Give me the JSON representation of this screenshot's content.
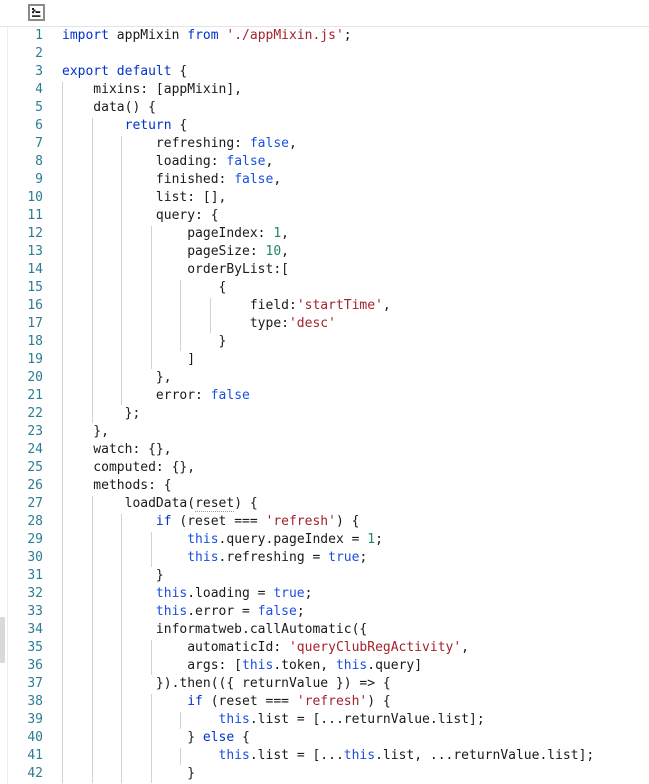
{
  "toolbar": {
    "icon": "terminal-icon",
    "icon_label": ">_"
  },
  "editor": {
    "language": "javascript",
    "first_visible_line": 1,
    "last_visible_line": 42,
    "line_height_px": 18,
    "colors": {
      "background": "#ffffff",
      "keyword": "#0033cc",
      "string": "#a3232e",
      "number": "#1a8a5a",
      "boolean": "#1a4fe0",
      "plain": "#1a1a1a",
      "line_number": "#2b7d95",
      "indent_guide": "#d2d2d2",
      "toolbar_border": "#e4e4e4"
    },
    "lines": [
      {
        "n": "1",
        "indent": 0,
        "tokens": [
          {
            "t": "import",
            "c": "kw"
          },
          {
            "t": " appMixin ",
            "c": "pl"
          },
          {
            "t": "from",
            "c": "kw"
          },
          {
            "t": " ",
            "c": "pl"
          },
          {
            "t": "'./appMixin.js'",
            "c": "str"
          },
          {
            "t": ";",
            "c": "pl"
          }
        ]
      },
      {
        "n": "2",
        "indent": 0,
        "tokens": []
      },
      {
        "n": "3",
        "indent": 0,
        "tokens": [
          {
            "t": "export default",
            "c": "kw"
          },
          {
            "t": " {",
            "c": "pl"
          }
        ]
      },
      {
        "n": "4",
        "indent": 1,
        "tokens": [
          {
            "t": "    mixins: [appMixin],",
            "c": "pl"
          }
        ]
      },
      {
        "n": "5",
        "indent": 1,
        "tokens": [
          {
            "t": "    data() {",
            "c": "pl"
          }
        ]
      },
      {
        "n": "6",
        "indent": 2,
        "tokens": [
          {
            "t": "        ",
            "c": "pl"
          },
          {
            "t": "return",
            "c": "kw"
          },
          {
            "t": " {",
            "c": "pl"
          }
        ]
      },
      {
        "n": "7",
        "indent": 3,
        "tokens": [
          {
            "t": "            refreshing: ",
            "c": "pl"
          },
          {
            "t": "false",
            "c": "bool"
          },
          {
            "t": ",",
            "c": "pl"
          }
        ]
      },
      {
        "n": "8",
        "indent": 3,
        "tokens": [
          {
            "t": "            loading: ",
            "c": "pl"
          },
          {
            "t": "false",
            "c": "bool"
          },
          {
            "t": ",",
            "c": "pl"
          }
        ]
      },
      {
        "n": "9",
        "indent": 3,
        "tokens": [
          {
            "t": "            finished: ",
            "c": "pl"
          },
          {
            "t": "false",
            "c": "bool"
          },
          {
            "t": ",",
            "c": "pl"
          }
        ]
      },
      {
        "n": "10",
        "indent": 3,
        "tokens": [
          {
            "t": "            list: [],",
            "c": "pl"
          }
        ]
      },
      {
        "n": "11",
        "indent": 3,
        "tokens": [
          {
            "t": "            query: {",
            "c": "pl"
          }
        ]
      },
      {
        "n": "12",
        "indent": 4,
        "tokens": [
          {
            "t": "                pageIndex: ",
            "c": "pl"
          },
          {
            "t": "1",
            "c": "num"
          },
          {
            "t": ",",
            "c": "pl"
          }
        ]
      },
      {
        "n": "13",
        "indent": 4,
        "tokens": [
          {
            "t": "                pageSize: ",
            "c": "pl"
          },
          {
            "t": "10",
            "c": "num"
          },
          {
            "t": ",",
            "c": "pl"
          }
        ]
      },
      {
        "n": "14",
        "indent": 4,
        "tokens": [
          {
            "t": "                orderByList:[",
            "c": "pl"
          }
        ]
      },
      {
        "n": "15",
        "indent": 5,
        "tokens": [
          {
            "t": "                    {",
            "c": "pl"
          }
        ]
      },
      {
        "n": "16",
        "indent": 6,
        "tokens": [
          {
            "t": "                        field:",
            "c": "pl"
          },
          {
            "t": "'startTime'",
            "c": "str"
          },
          {
            "t": ",",
            "c": "pl"
          }
        ]
      },
      {
        "n": "17",
        "indent": 6,
        "tokens": [
          {
            "t": "                        type:",
            "c": "pl"
          },
          {
            "t": "'desc'",
            "c": "str"
          }
        ]
      },
      {
        "n": "18",
        "indent": 5,
        "tokens": [
          {
            "t": "                    }",
            "c": "pl"
          }
        ]
      },
      {
        "n": "19",
        "indent": 4,
        "tokens": [
          {
            "t": "                ]",
            "c": "pl"
          }
        ]
      },
      {
        "n": "20",
        "indent": 3,
        "tokens": [
          {
            "t": "            },",
            "c": "pl"
          }
        ]
      },
      {
        "n": "21",
        "indent": 3,
        "tokens": [
          {
            "t": "            error: ",
            "c": "pl"
          },
          {
            "t": "false",
            "c": "bool"
          }
        ]
      },
      {
        "n": "22",
        "indent": 2,
        "tokens": [
          {
            "t": "        };",
            "c": "pl"
          }
        ]
      },
      {
        "n": "23",
        "indent": 1,
        "tokens": [
          {
            "t": "    },",
            "c": "pl"
          }
        ]
      },
      {
        "n": "24",
        "indent": 1,
        "tokens": [
          {
            "t": "    watch: {},",
            "c": "pl"
          }
        ]
      },
      {
        "n": "25",
        "indent": 1,
        "tokens": [
          {
            "t": "    computed: {},",
            "c": "pl"
          }
        ]
      },
      {
        "n": "26",
        "indent": 1,
        "tokens": [
          {
            "t": "    methods: {",
            "c": "pl"
          }
        ]
      },
      {
        "n": "27",
        "indent": 2,
        "tokens": [
          {
            "t": "        loadData(",
            "c": "pl"
          },
          {
            "t": "reset",
            "c": "param"
          },
          {
            "t": ") {",
            "c": "pl"
          }
        ]
      },
      {
        "n": "28",
        "indent": 3,
        "tokens": [
          {
            "t": "            ",
            "c": "pl"
          },
          {
            "t": "if",
            "c": "kw"
          },
          {
            "t": " (reset === ",
            "c": "pl"
          },
          {
            "t": "'refresh'",
            "c": "str"
          },
          {
            "t": ") {",
            "c": "pl"
          }
        ]
      },
      {
        "n": "29",
        "indent": 4,
        "tokens": [
          {
            "t": "                ",
            "c": "pl"
          },
          {
            "t": "this",
            "c": "this"
          },
          {
            "t": ".query.pageIndex = ",
            "c": "pl"
          },
          {
            "t": "1",
            "c": "num"
          },
          {
            "t": ";",
            "c": "pl"
          }
        ]
      },
      {
        "n": "30",
        "indent": 4,
        "tokens": [
          {
            "t": "                ",
            "c": "pl"
          },
          {
            "t": "this",
            "c": "this"
          },
          {
            "t": ".refreshing = ",
            "c": "pl"
          },
          {
            "t": "true",
            "c": "bool"
          },
          {
            "t": ";",
            "c": "pl"
          }
        ]
      },
      {
        "n": "31",
        "indent": 3,
        "tokens": [
          {
            "t": "            }",
            "c": "pl"
          }
        ]
      },
      {
        "n": "32",
        "indent": 3,
        "tokens": [
          {
            "t": "            ",
            "c": "pl"
          },
          {
            "t": "this",
            "c": "this"
          },
          {
            "t": ".loading = ",
            "c": "pl"
          },
          {
            "t": "true",
            "c": "bool"
          },
          {
            "t": ";",
            "c": "pl"
          }
        ]
      },
      {
        "n": "33",
        "indent": 3,
        "tokens": [
          {
            "t": "            ",
            "c": "pl"
          },
          {
            "t": "this",
            "c": "this"
          },
          {
            "t": ".error = ",
            "c": "pl"
          },
          {
            "t": "false",
            "c": "bool"
          },
          {
            "t": ";",
            "c": "pl"
          }
        ]
      },
      {
        "n": "34",
        "indent": 3,
        "tokens": [
          {
            "t": "            informatweb.callAutomatic({",
            "c": "pl"
          }
        ]
      },
      {
        "n": "35",
        "indent": 4,
        "tokens": [
          {
            "t": "                automaticId: ",
            "c": "pl"
          },
          {
            "t": "'queryClubRegActivity'",
            "c": "str"
          },
          {
            "t": ",",
            "c": "pl"
          }
        ]
      },
      {
        "n": "36",
        "indent": 4,
        "tokens": [
          {
            "t": "                args: [",
            "c": "pl"
          },
          {
            "t": "this",
            "c": "this"
          },
          {
            "t": ".token, ",
            "c": "pl"
          },
          {
            "t": "this",
            "c": "this"
          },
          {
            "t": ".query]",
            "c": "pl"
          }
        ]
      },
      {
        "n": "37",
        "indent": 3,
        "tokens": [
          {
            "t": "            }).then(({ returnValue }) => {",
            "c": "pl"
          }
        ]
      },
      {
        "n": "38",
        "indent": 4,
        "tokens": [
          {
            "t": "                ",
            "c": "pl"
          },
          {
            "t": "if",
            "c": "kw"
          },
          {
            "t": " (reset === ",
            "c": "pl"
          },
          {
            "t": "'refresh'",
            "c": "str"
          },
          {
            "t": ") {",
            "c": "pl"
          }
        ]
      },
      {
        "n": "39",
        "indent": 5,
        "tokens": [
          {
            "t": "                    ",
            "c": "pl"
          },
          {
            "t": "this",
            "c": "this"
          },
          {
            "t": ".list = [...returnValue.list];",
            "c": "pl"
          }
        ]
      },
      {
        "n": "40",
        "indent": 4,
        "tokens": [
          {
            "t": "                } ",
            "c": "pl"
          },
          {
            "t": "else",
            "c": "kw"
          },
          {
            "t": " {",
            "c": "pl"
          }
        ]
      },
      {
        "n": "41",
        "indent": 5,
        "tokens": [
          {
            "t": "                    ",
            "c": "pl"
          },
          {
            "t": "this",
            "c": "this"
          },
          {
            "t": ".list = [...",
            "c": "pl"
          },
          {
            "t": "this",
            "c": "this"
          },
          {
            "t": ".list, ...returnValue.list];",
            "c": "pl"
          }
        ]
      },
      {
        "n": "42",
        "indent": 4,
        "tokens": [
          {
            "t": "                }",
            "c": "pl"
          }
        ]
      }
    ]
  }
}
